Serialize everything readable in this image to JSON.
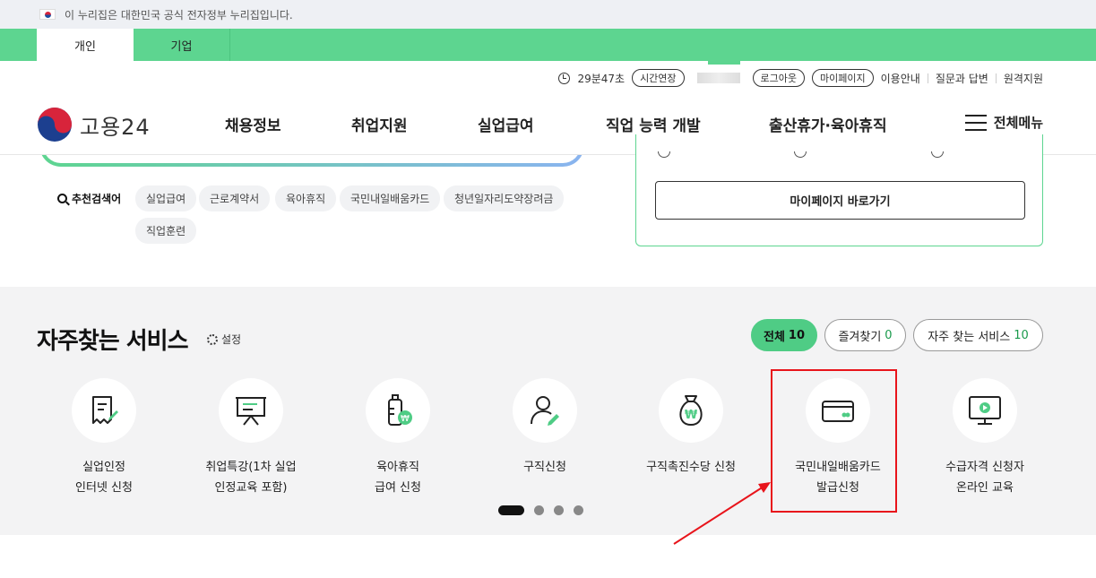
{
  "gov_banner": {
    "text": "이 누리집은 대한민국 공식 전자정부 누리집입니다."
  },
  "audience_tabs": [
    {
      "label": "개인"
    },
    {
      "label": "기업"
    }
  ],
  "util": {
    "timer": "29분47초",
    "extend_label": "시간연장",
    "logout_label": "로그아웃",
    "mypage_label": "마이페이지",
    "links": [
      "이용안내",
      "질문과 답변",
      "원격지원"
    ]
  },
  "logo": {
    "text": "고용24"
  },
  "gnb": [
    "채용정보",
    "취업지원",
    "실업급여",
    "직업 능력 개발",
    "출산휴가·육아휴직"
  ],
  "all_menu": "전체메뉴",
  "recommend": {
    "label": "추천검색어",
    "keywords": [
      "실업급여",
      "근로계약서",
      "육아휴직",
      "국민내일배움카드",
      "청년일자리도약장려금",
      "직업훈련"
    ]
  },
  "mypanel": {
    "button_label": "마이페이지 바로가기"
  },
  "services": {
    "title": "자주찾는 서비스",
    "setting_label": "설정",
    "filters": [
      {
        "label": "전체",
        "count": "10"
      },
      {
        "label": "즐겨찾기",
        "count": "0"
      },
      {
        "label": "자주 찾는 서비스",
        "count": "10"
      }
    ],
    "items": [
      {
        "label": "실업인정\n인터넷 신청",
        "icon": "document-pen-icon"
      },
      {
        "label": "취업특강(1차 실업\n인정교육 포함)",
        "icon": "presentation-board-icon"
      },
      {
        "label": "육아휴직\n급여 신청",
        "icon": "baby-bottle-won-icon"
      },
      {
        "label": "구직신청",
        "icon": "person-pen-icon"
      },
      {
        "label": "구직촉진수당 신청",
        "icon": "money-bag-won-icon"
      },
      {
        "label": "국민내일배움카드\n발급신청",
        "icon": "card-icon"
      },
      {
        "label": "수급자격 신청자\n온라인 교육",
        "icon": "monitor-play-icon"
      }
    ],
    "pager_pages": 4,
    "pager_active": 1
  },
  "colors": {
    "brand_green": "#5dd590",
    "active_filter": "#4fcc85",
    "highlight": "#e8141b"
  }
}
